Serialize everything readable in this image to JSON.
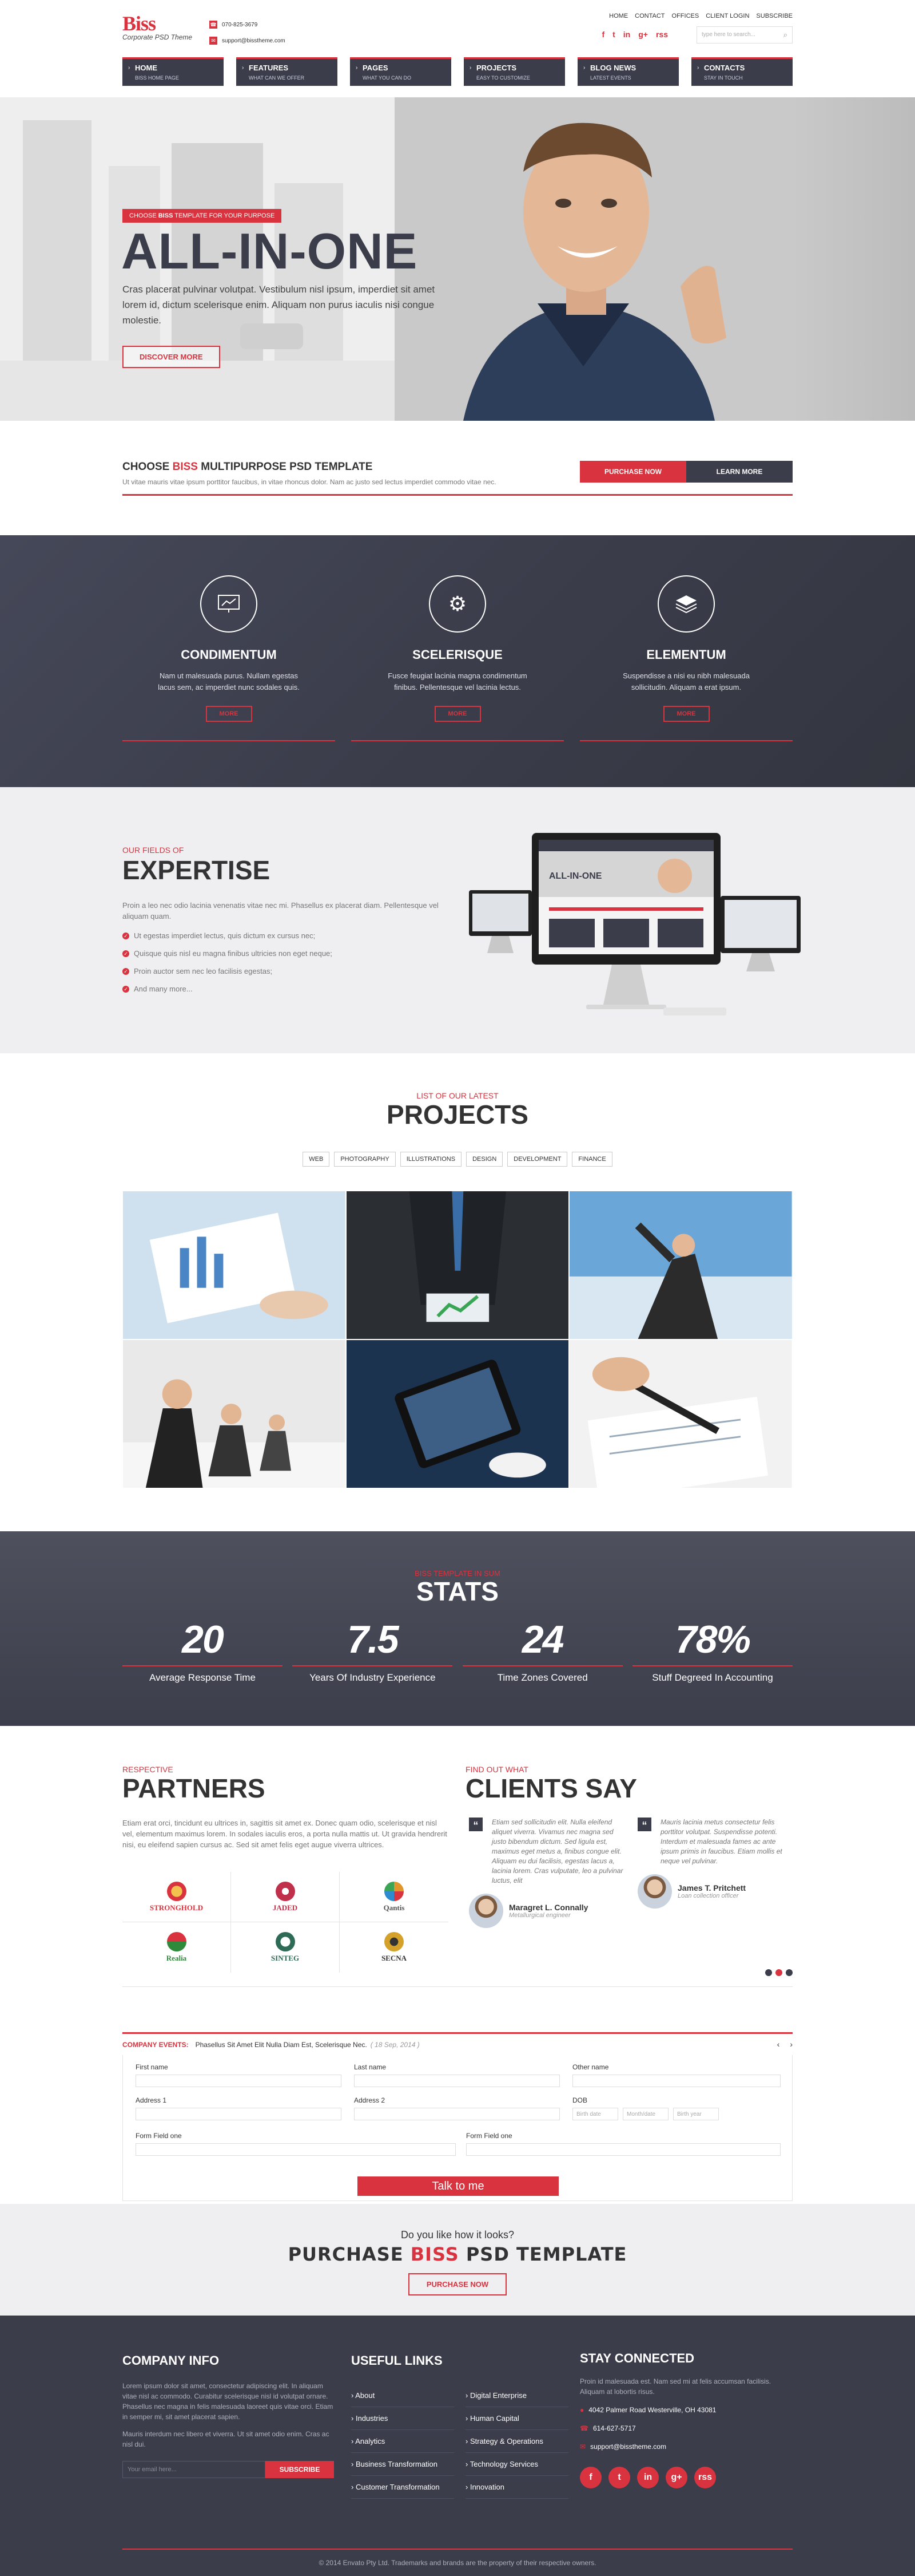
{
  "header": {
    "logo_name": "Biss",
    "logo_sub": "Corporate PSD Theme",
    "phone": "070-825-3679",
    "email": "support@bisstheme.com",
    "toplinks": [
      "HOME",
      "CONTACT",
      "OFFICES",
      "CLIENT LOGIN",
      "SUBSCRIBE"
    ],
    "search_placeholder": "type here to search...",
    "social": [
      "f",
      "t",
      "in",
      "g+",
      "rss"
    ]
  },
  "nav": [
    {
      "title": "HOME",
      "sub": "BISS HOME PAGE"
    },
    {
      "title": "FEATURES",
      "sub": "WHAT CAN WE OFFER"
    },
    {
      "title": "PAGES",
      "sub": "WHAT YOU CAN DO"
    },
    {
      "title": "PROJECTS",
      "sub": "EASY TO CUSTOMIZE"
    },
    {
      "title": "BLOG NEWS",
      "sub": "LATEST EVENTS"
    },
    {
      "title": "CONTACTS",
      "sub": "STAY IN TOUCH"
    }
  ],
  "hero": {
    "tag_prefix": "CHOOSE ",
    "tag_brand": "BISS",
    "tag_suffix": " TEMPLATE FOR YOUR PURPOSE",
    "title": "ALL-IN-ONE",
    "text": "Cras placerat pulvinar volutpat. Vestibulum nisl ipsum, imperdiet sit amet lorem id, dictum scelerisque enim. Aliquam non purus iaculis nisi congue molestie.",
    "button": "DISCOVER MORE"
  },
  "choose": {
    "title_prefix": "CHOOSE ",
    "title_brand": "BISS",
    "title_suffix": " MULTIPURPOSE PSD TEMPLATE",
    "text": "Ut vitae mauris vitae ipsum porttitor faucibus, in vitae rhoncus dolor. Nam ac justo sed lectus imperdiet commodo vitae nec.",
    "btn_purchase": "PURCHASE NOW",
    "btn_learn": "LEARN MORE"
  },
  "services": [
    {
      "icon": "chart-icon",
      "title": "CONDIMENTUM",
      "text": "Nam ut malesuada purus. Nullam egestas lacus sem, ac imperdiet nunc sodales quis.",
      "more": "MORE"
    },
    {
      "icon": "gear-icon",
      "title": "SCELERISQUE",
      "text": "Fusce feugiat lacinia magna condimentum finibus. Pellentesque vel lacinia lectus.",
      "more": "MORE"
    },
    {
      "icon": "layers-icon",
      "title": "ELEMENTUM",
      "text": "Suspendisse a nisi eu nibh malesuada sollicitudin. Aliquam a erat ipsum.",
      "more": "MORE"
    }
  ],
  "expertise": {
    "kicker": "OUR FIELDS OF",
    "title": "EXPERTISE",
    "intro": "Proin a leo nec odio lacinia venenatis vitae nec mi. Phasellus ex placerat diam. Pellentesque vel aliquam quam.",
    "items": [
      "Ut egestas imperdiet lectus, quis dictum ex cursus nec;",
      "Quisque quis nisl eu magna finibus ultricies non eget neque;",
      "Proin auctor sem nec leo facilisis egestas;",
      "And many more..."
    ]
  },
  "projects": {
    "kicker": "LIST OF OUR LATEST",
    "title": "PROJECTS",
    "filters": [
      "WEB",
      "PHOTOGRAPHY",
      "ILLUSTRATIONS",
      "DESIGN",
      "DEVELOPMENT",
      "FINANCE"
    ]
  },
  "stats": {
    "kicker": "BISS TEMPLATE IN SUM",
    "title": "STATS",
    "items": [
      {
        "num": "20",
        "label": "Average Response Time"
      },
      {
        "num": "7.5",
        "label": "Years Of Industry Experience"
      },
      {
        "num": "24",
        "label": "Time Zones Covered"
      },
      {
        "num": "78%",
        "label": "Stuff Degreed In Accounting"
      }
    ]
  },
  "partners": {
    "kicker": "RESPECTIVE",
    "title": "PARTNERS",
    "text": "Etiam erat orci, tincidunt eu ultrices in, sagittis sit amet ex. Donec quam odio, scelerisque et nisl vel, elementum maximus lorem. In sodales iaculis eros, a porta nulla mattis ut. Ut gravida hendrerit nisi, eu eleifend sapien cursus ac. Sed sit amet felis eget augue viverra ultrices.",
    "logos": [
      {
        "name": "STRONGHOLD",
        "color": "#d8333e"
      },
      {
        "name": "JADED",
        "color": "#c0304a"
      },
      {
        "name": "Qantis",
        "color": "#e0962a"
      },
      {
        "name": "Realia",
        "color": "#2f8a3b"
      },
      {
        "name": "SINTEG",
        "color": "#2e6b57"
      },
      {
        "name": "SECNA",
        "color": "#d4a12a"
      }
    ]
  },
  "clients": {
    "kicker": "FIND OUT WHAT",
    "title": "CLIENTS SAY",
    "items": [
      {
        "text": "Etiam sed sollicitudin elit. Nulla eleifend aliquet viverra. Vivamus nec magna sed justo bibendum dictum. Sed ligula est, maximus eget metus a, finibus congue elit. Aliquam eu dui facilisis, egestas lacus a, lacinia lorem. Cras vulputate, leo a pulvinar luctus, elit",
        "name": "Maragret L. Connally",
        "role": "Metallurgical engineer"
      },
      {
        "text": "Mauris lacinia metus consectetur felis porttitor volutpat. Suspendisse potenti. Interdum et malesuada fames ac ante ipsum primis in faucibus. Etiam mollis et neque vel pulvinar.",
        "name": "James T. Pritchett",
        "role": "Loan collection officer"
      }
    ]
  },
  "events": {
    "label": "COMPANY EVENTS:",
    "text": "Phasellus Sit Amet Elit Nulla Diam Est, Scelerisque Nec.",
    "date": "( 18 Sep, 2014 )"
  },
  "form": {
    "first_name": "First name",
    "last_name": "Last  name",
    "other_name": "Other name",
    "address1": "Address 1",
    "address2": "Address 2",
    "dob": "DOB",
    "dob_day": "Birth date",
    "dob_month": "Month/date",
    "dob_year": "Birth year",
    "field1": "Form Field one",
    "field2": "Form Field one",
    "submit": "Talk to me"
  },
  "purchase": {
    "question": "Do you like how it looks?",
    "title_prefix": "PURCHASE ",
    "title_brand": "BISS",
    "title_suffix": " PSD TEMPLATE",
    "button": "PURCHASE NOW"
  },
  "footer": {
    "info_title": "COMPANY INFO",
    "info_text1": "Lorem ipsum dolor sit amet, consectetur adipiscing elit. In aliquam vitae nisl ac commodo. Curabitur scelerisque nisl id volutpat ornare. Phasellus nec magna in felis malesuada laoreet quis vitae orci. Etiam in semper mi, sit amet placerat sapien.",
    "info_text2": "Mauris interdum nec libero et viverra. Ut sit amet odio enim. Cras ac nisl dui.",
    "newsletter_placeholder": "Your email here...",
    "subscribe": "SUBSCRIBE",
    "links_title": "USEFUL LINKS",
    "links": [
      "About",
      "Digital Enterprise",
      "Industries",
      "Human Capital",
      "Analytics",
      "Strategy & Operations",
      "Business Transformation",
      "Technology Services",
      "Customer Transformation",
      "Innovation"
    ],
    "stay_title": "STAY CONNECTED",
    "stay_text": "Proin id malesuada est. Nam sed mi at felis accumsan facilisis. Aliquam at lobortis risus.",
    "address": "4042 Palmer Road Westerville, OH 43081",
    "phone": "614-627-5717",
    "email": "support@bisstheme.com",
    "social": [
      "f",
      "t",
      "in",
      "g+",
      "rss"
    ],
    "copyright": "© 2014 Envato Pty Ltd. Trademarks and brands are the property of their respective owners."
  },
  "colors": {
    "accent": "#d8333e",
    "dark": "#3b3d4b"
  }
}
